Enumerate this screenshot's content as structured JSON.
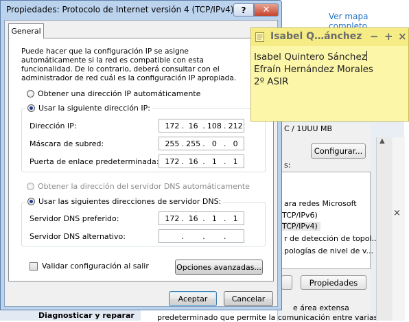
{
  "background": {
    "map_link": "Ver mapa completo",
    "partial_lines": [
      "C / 1UUU MB",
      "s:",
      "ara redes Microsoft",
      "TCP/IPv6)",
      "TCP/IPv4)",
      "r de detección de topol...",
      "pologías de nivel de v..."
    ],
    "configure_button": "Configurar...",
    "properties_button": "Propiedades",
    "bottom_lines": [
      "e área extensa",
      "predeterminado que permite la comunicación entre varias"
    ],
    "left_bottom_text": "Diagnosticar y reparar",
    "scroll_labels": [
      "▲",
      "×"
    ]
  },
  "dialog": {
    "title": "Propiedades: Protocolo de Internet versión 4 (TCP/IPv4)",
    "help_label": "?",
    "close_label": "✕",
    "tab": "General",
    "description": "Puede hacer que la configuración IP se asigne automáticamente si la red es compatible con esta funcionalidad. De lo contrario, deberá consultar con el administrador de red cuál es la configuración IP apropiada.",
    "ip_auto_label": "Obtener una dirección IP automáticamente",
    "ip_manual_label": "Usar la siguiente dirección IP:",
    "ip_fields": [
      {
        "label": "Dirección IP:",
        "octets": [
          "172",
          "16",
          "108",
          "212"
        ]
      },
      {
        "label": "Máscara de subred:",
        "octets": [
          "255",
          "255",
          "0",
          "0"
        ]
      },
      {
        "label": "Puerta de enlace predeterminada:",
        "octets": [
          "172",
          "16",
          "1",
          "1"
        ]
      }
    ],
    "dns_auto_label": "Obtener la dirección del servidor DNS automáticamente",
    "dns_manual_label": "Usar las siguientes direcciones de servidor DNS:",
    "dns_fields": [
      {
        "label": "Servidor DNS preferido:",
        "octets": [
          "172",
          "16",
          "1",
          "1"
        ]
      },
      {
        "label": "Servidor DNS alternativo:",
        "octets": [
          "",
          "",
          "",
          ""
        ]
      }
    ],
    "validate_label": "Validar configuración al salir",
    "advanced_button": "Opciones avanzadas...",
    "accept_button": "Aceptar",
    "cancel_button": "Cancelar",
    "dot": "."
  },
  "sticky": {
    "title": "Isabel Q…ánchez",
    "minimize": "−",
    "add": "+",
    "close": "×",
    "lines": [
      "Isabel Quintero Sánchez",
      "Efraín Hernández Morales",
      "2º ASIR"
    ]
  }
}
